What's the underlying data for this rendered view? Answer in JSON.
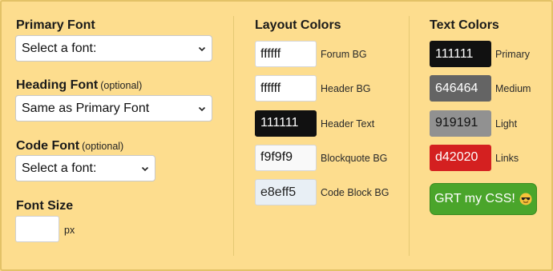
{
  "fonts": {
    "primary": {
      "title": "Primary Font",
      "value": "Select a font:"
    },
    "heading": {
      "title": "Heading Font",
      "optional": "(optional)",
      "value": "Same as Primary Font"
    },
    "code": {
      "title": "Code Font",
      "optional": "(optional)",
      "value": "Select a font:"
    },
    "size": {
      "title": "Font Size",
      "value": "",
      "unit": "px"
    }
  },
  "layout_colors": {
    "title": "Layout Colors",
    "items": [
      {
        "value": "ffffff",
        "label": "Forum BG",
        "color": "#ffffff",
        "text_color": "#111111"
      },
      {
        "value": "ffffff",
        "label": "Header BG",
        "color": "#ffffff",
        "text_color": "#111111"
      },
      {
        "value": "111111",
        "label": "Header Text",
        "color": "#111111",
        "text_color": "#ffffff"
      },
      {
        "value": "f9f9f9",
        "label": "Blockquote BG",
        "color": "#f9f9f9",
        "text_color": "#111111"
      },
      {
        "value": "e8eff5",
        "label": "Code Block BG",
        "color": "#e8eff5",
        "text_color": "#222222"
      }
    ]
  },
  "text_colors": {
    "title": "Text Colors",
    "items": [
      {
        "value": "111111",
        "label": "Primary",
        "color": "#111111",
        "text_color": "#ffffff"
      },
      {
        "value": "646464",
        "label": "Medium",
        "color": "#646464",
        "text_color": "#ffffff"
      },
      {
        "value": "919191",
        "label": "Light",
        "color": "#919191",
        "text_color": "#111111"
      },
      {
        "value": "d42020",
        "label": "Links",
        "color": "#d42020",
        "text_color": "#ffffff"
      }
    ]
  },
  "submit": {
    "label": "GRT my CSS!",
    "icon": "sunglasses-emoji-icon"
  },
  "theme": {
    "background": "#fddd8e",
    "button": "#4aa52b"
  }
}
